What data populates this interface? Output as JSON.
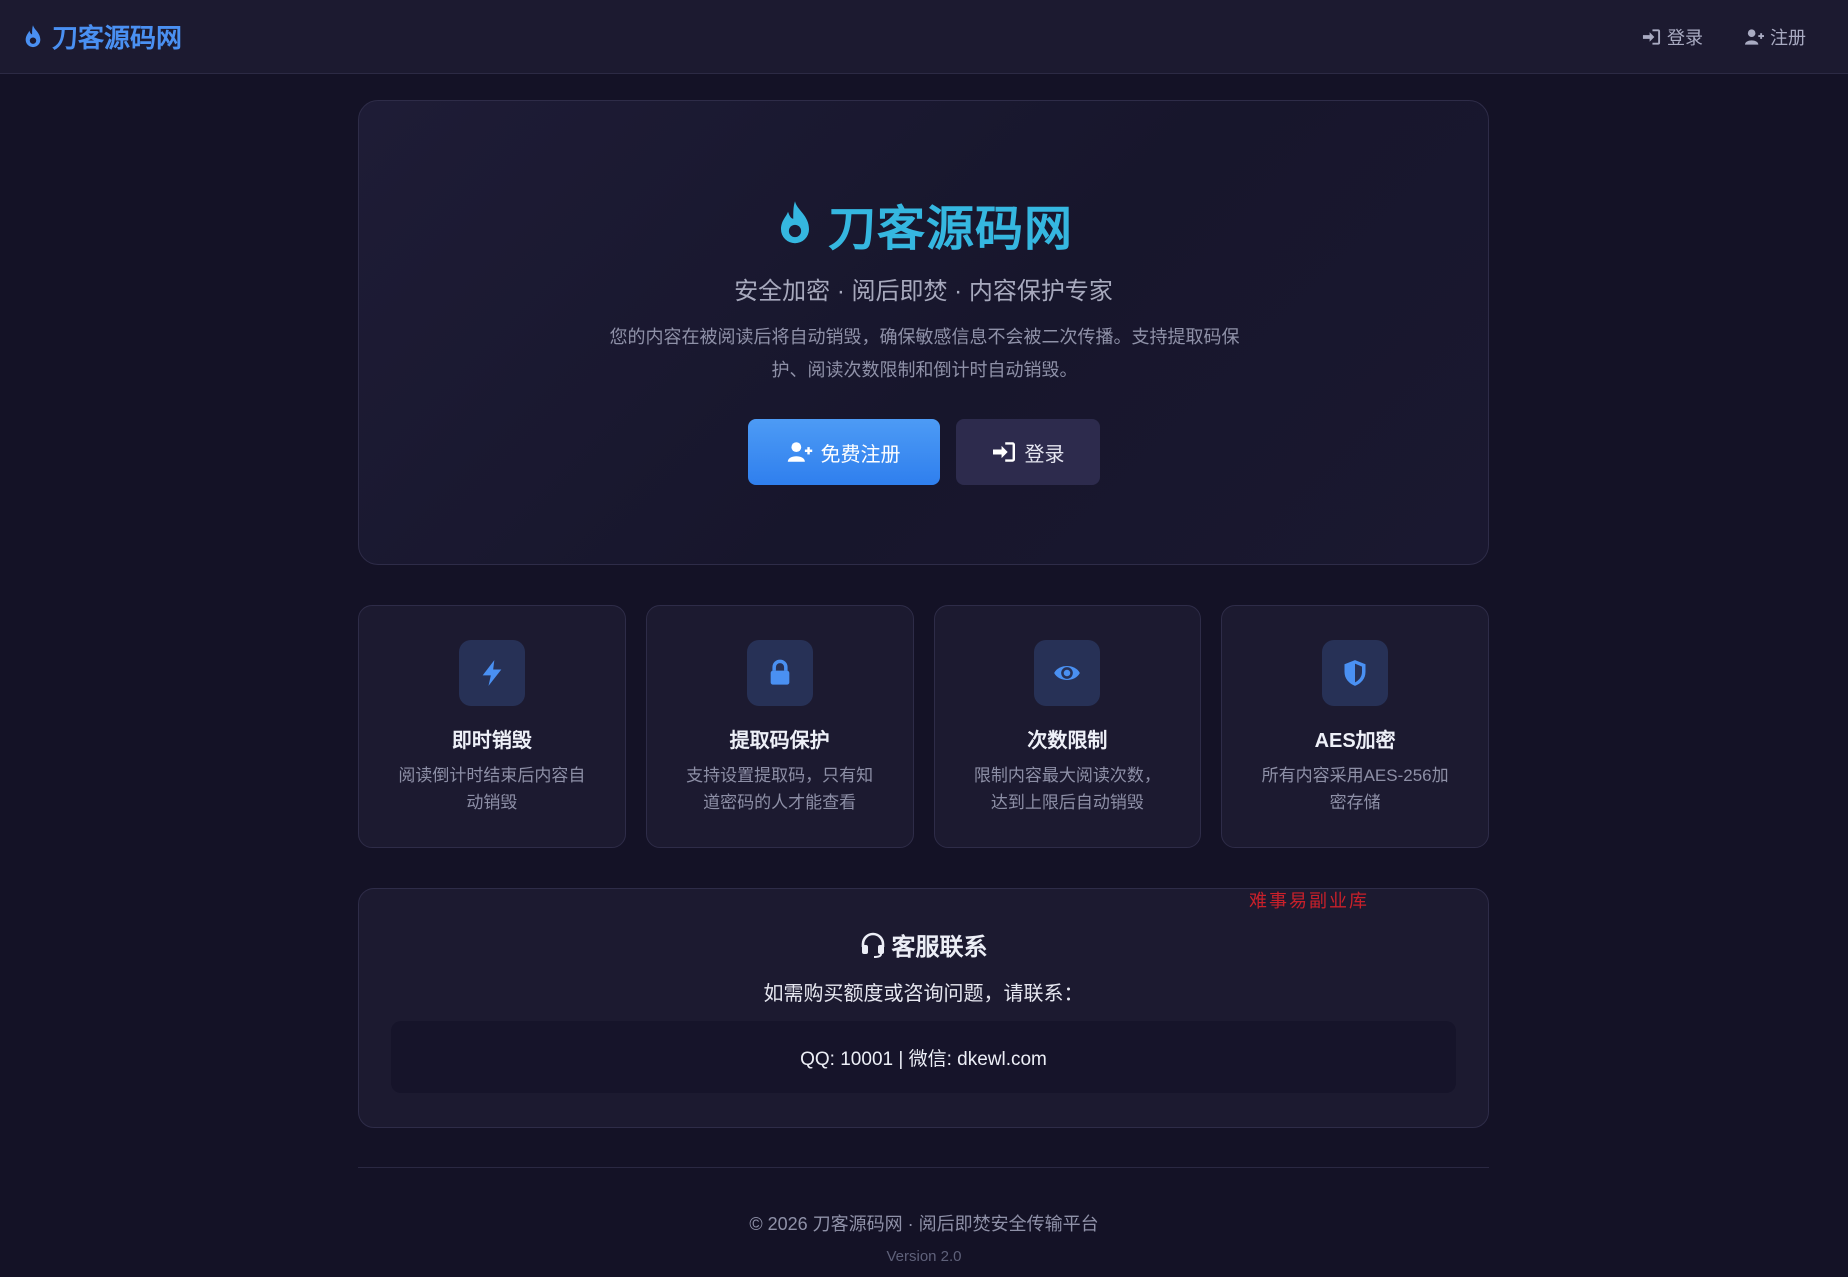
{
  "navbar": {
    "brand": "刀客源码网",
    "login_label": "登录",
    "register_label": "注册"
  },
  "hero": {
    "title": "刀客源码网",
    "subtitle": "安全加密 · 阅后即焚 · 内容保护专家",
    "description": "您的内容在被阅读后将自动销毁，确保敏感信息不会被二次传播。支持提取码保护、阅读次数限制和倒计时自动销毁。",
    "register_button": "免费注册",
    "login_button": "登录"
  },
  "features": [
    {
      "icon": "lightning-icon",
      "title": "即时销毁",
      "desc": "阅读倒计时结束后内容自动销毁"
    },
    {
      "icon": "lock-icon",
      "title": "提取码保护",
      "desc": "支持设置提取码，只有知道密码的人才能查看"
    },
    {
      "icon": "eye-icon",
      "title": "次数限制",
      "desc": "限制内容最大阅读次数，达到上限后自动销毁"
    },
    {
      "icon": "shield-icon",
      "title": "AES加密",
      "desc": "所有内容采用AES-256加密存储"
    }
  ],
  "contact": {
    "title": "客服联系",
    "subtitle": "如需购买额度或咨询问题，请联系：",
    "info": "QQ: 10001 | 微信: dkewl.com",
    "watermark": "难事易副业库"
  },
  "footer": {
    "copyright": "© 2026 刀客源码网 · 阅后即焚安全传输平台",
    "version": "Version 2.0"
  },
  "colors": {
    "accent": "#4a90f2",
    "title_cyan": "#35b7e0",
    "background": "#141226",
    "card": "#1c1a30"
  }
}
